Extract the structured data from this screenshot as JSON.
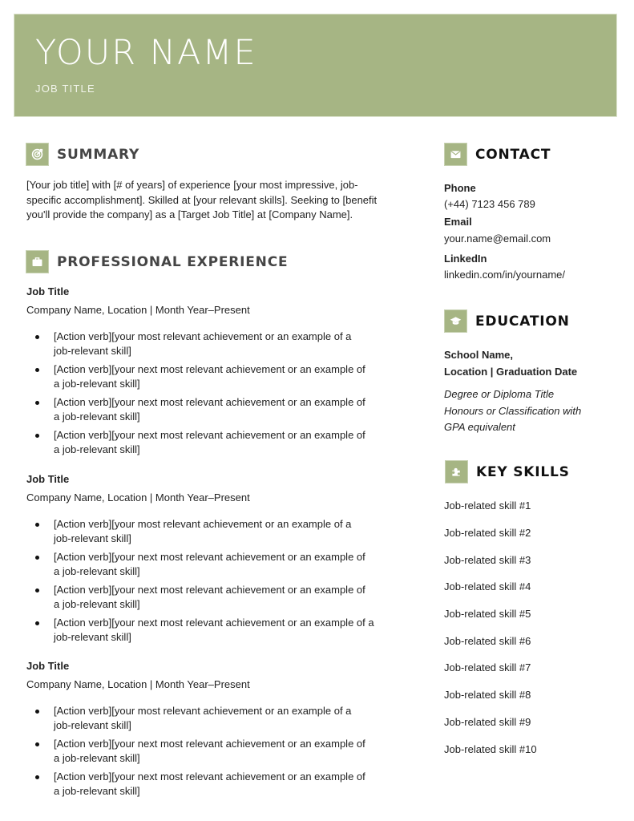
{
  "header": {
    "name": "YOUR NAME",
    "job_title": "JOB TITLE",
    "accent_color": "#a6b584"
  },
  "summary": {
    "title": "SUMMARY",
    "icon": "target-icon",
    "lines": [
      "[Your job title] with [# of years] of experience [your most impressive, job-",
      "specific accomplishment]. Skilled at [your relevant skills]. Seeking to [benefit",
      "you'll provide the company] as a [Target Job Title] at [Company Name]."
    ]
  },
  "experience": {
    "title": "PROFESSIONAL EXPERIENCE",
    "icon": "briefcase-icon",
    "jobs": [
      {
        "title": "Job Title",
        "meta": "Company Name, Location | Month Year–Present",
        "bullets": [
          [
            "[Action verb][your most relevant achievement or an example of a",
            "job-relevant skill]"
          ],
          [
            "[Action verb][your next most relevant achievement or an example of",
            "a job-relevant skill]"
          ],
          [
            "[Action verb][your next most relevant achievement or an example of",
            "a job-relevant skill]"
          ],
          [
            "[Action verb][your next most relevant achievement or an example of",
            "a job-relevant skill]"
          ]
        ]
      },
      {
        "title": "Job Title",
        "meta": "Company Name, Location | Month Year–Present",
        "bullets": [
          [
            "[Action verb][your most relevant achievement or an example of a",
            "job-relevant skill]"
          ],
          [
            "[Action verb][your next most relevant achievement or an example of",
            "a job-relevant skill]"
          ],
          [
            "[Action verb][your next most relevant achievement or an example of",
            "a job-relevant skill]"
          ],
          [
            "[Action verb][your next most relevant achievement or an example of a",
            "job-relevant skill]"
          ]
        ]
      },
      {
        "title": "Job Title",
        "meta": "Company Name, Location | Month Year–Present",
        "bullets": [
          [
            "[Action verb][your most relevant achievement or an example of a",
            "job-relevant skill]"
          ],
          [
            "[Action verb][your next most relevant achievement or an example of",
            "a job-relevant skill]"
          ],
          [
            "[Action verb][your next most relevant achievement or an example of",
            "a job-relevant skill]"
          ]
        ]
      }
    ]
  },
  "contact": {
    "title": "CONTACT",
    "icon": "envelope-icon",
    "phone_label": "Phone",
    "phone": "(+44) 7123 456 789",
    "email_label": "Email",
    "email": "your.name@email.com",
    "linkedin_label": "LinkedIn",
    "linkedin": "linkedin.com/in/yourname/"
  },
  "education": {
    "title": "EDUCATION",
    "icon": "graduation-cap-icon",
    "school_line1": "School Name,",
    "school_line2": "Location | Graduation Date",
    "degree_lines": [
      "Degree or Diploma Title",
      "Honours or Classification with",
      "GPA equivalent"
    ]
  },
  "skills": {
    "title": "KEY SKILLS",
    "icon": "puzzle-icon",
    "items": [
      "Job-related skill #1",
      "Job-related skill #2",
      "Job-related skill #3",
      "Job-related skill #4",
      "Job-related skill #5",
      "Job-related skill #6",
      "Job-related skill #7",
      "Job-related skill #8",
      "Job-related skill #9",
      "Job-related skill #10"
    ]
  }
}
